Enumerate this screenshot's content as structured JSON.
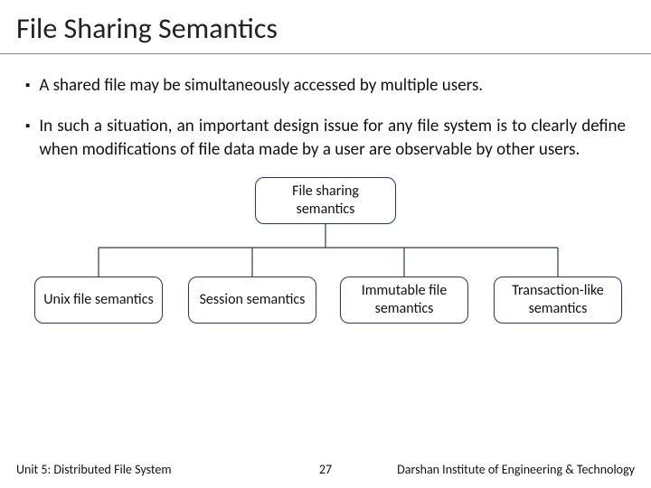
{
  "title": "File Sharing Semantics",
  "bullets": [
    "A shared file may be simultaneously accessed by multiple users.",
    "In such a situation, an important design issue for any file system is to clearly define when modifications of file data made by a user are observable by other users."
  ],
  "diagram": {
    "root": "File sharing semantics",
    "children": [
      "Unix file semantics",
      "Session semantics",
      "Immutable file semantics",
      "Transaction-like semantics"
    ]
  },
  "footer": {
    "left": "Unit 5: Distributed File System",
    "center": "27",
    "right": "Darshan Institute of Engineering & Technology"
  }
}
